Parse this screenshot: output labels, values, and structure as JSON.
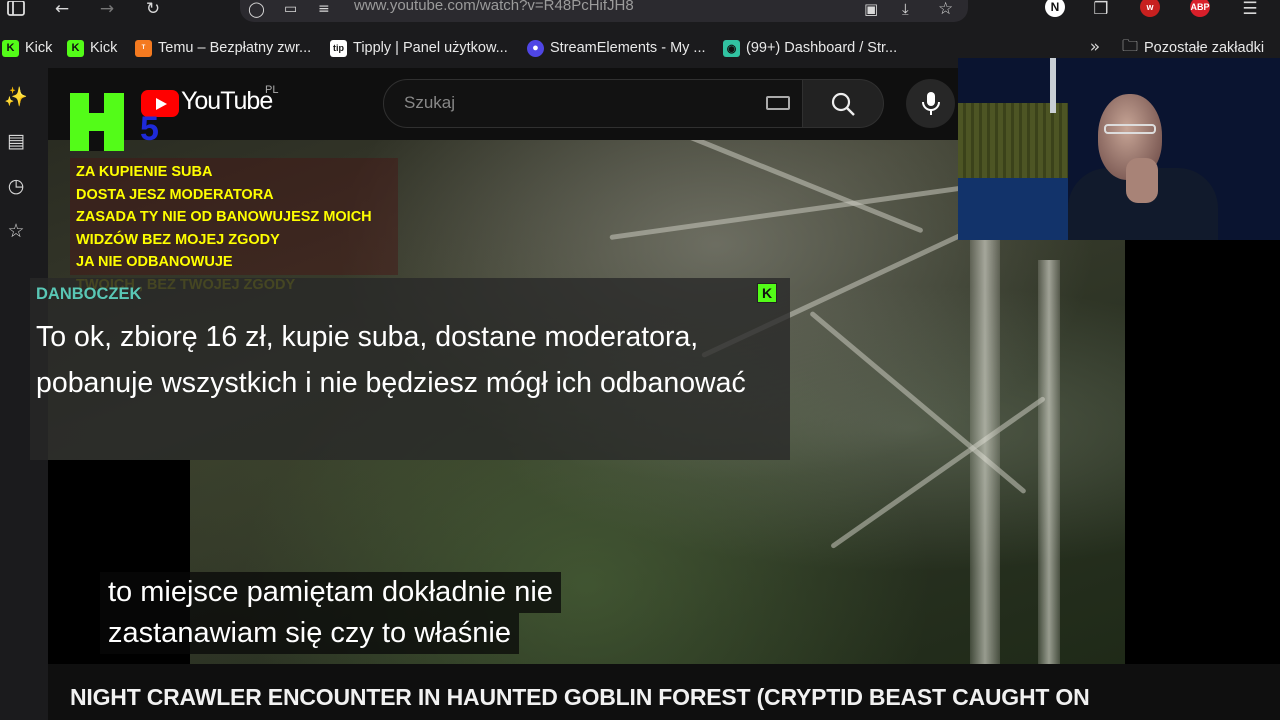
{
  "browser": {
    "url": "www.youtube.com/watch?v=R48PcHifJH8",
    "badge_n": "N",
    "badge_abp": "ABP",
    "badge_w": "w"
  },
  "bookmarks": [
    {
      "label": "Kick",
      "icon": "kick-icon",
      "color": "#53fc18"
    },
    {
      "label": "Kick",
      "icon": "kick-icon",
      "color": "#53fc18"
    },
    {
      "label": "Temu – Bezpłatny zwr...",
      "icon": "temu-icon",
      "color": "#f47a20"
    },
    {
      "label": "Tipply | Panel użytkow...",
      "icon": "tipply-icon",
      "color": "#111111"
    },
    {
      "label": "StreamElements - My ...",
      "icon": "streamelements-icon",
      "color": "#4f46e5"
    },
    {
      "label": "(99+) Dashboard / Str...",
      "icon": "streamlabs-icon",
      "color": "#31c3a2"
    }
  ],
  "bookmarks_other": "Pozostałe zakładki",
  "youtube": {
    "logo_text": "YouTube",
    "region": "PL",
    "search_placeholder": "Szukaj"
  },
  "overlay": {
    "five": "5",
    "rules": [
      "ZA KUPIENIE SUBA",
      "DOSTA JESZ MODERATORA",
      "ZASADA  TY NIE OD BANOWUJESZ MOICH",
      "WIDZÓW BEZ MOJEJ ZGODY",
      "JA NIE ODBANOWUJE",
      "TWOICH , BEZ TWOJEJ ZGODY"
    ]
  },
  "chat": {
    "username": "DANBOCZEK",
    "badge": "K",
    "message": "To ok, zbiorę 16 zł, kupie suba, dostane moderatora, pobanuje wszystkich i nie będziesz mógł ich odbanować"
  },
  "subtitles": [
    "to miejsce pamiętam dokładnie nie",
    "zastanawiam się czy to właśnie"
  ],
  "video": {
    "title": "NIGHT CRAWLER ENCOUNTER IN HAUNTED GOBLIN FOREST (CRYPTID BEAST CAUGHT ON"
  }
}
